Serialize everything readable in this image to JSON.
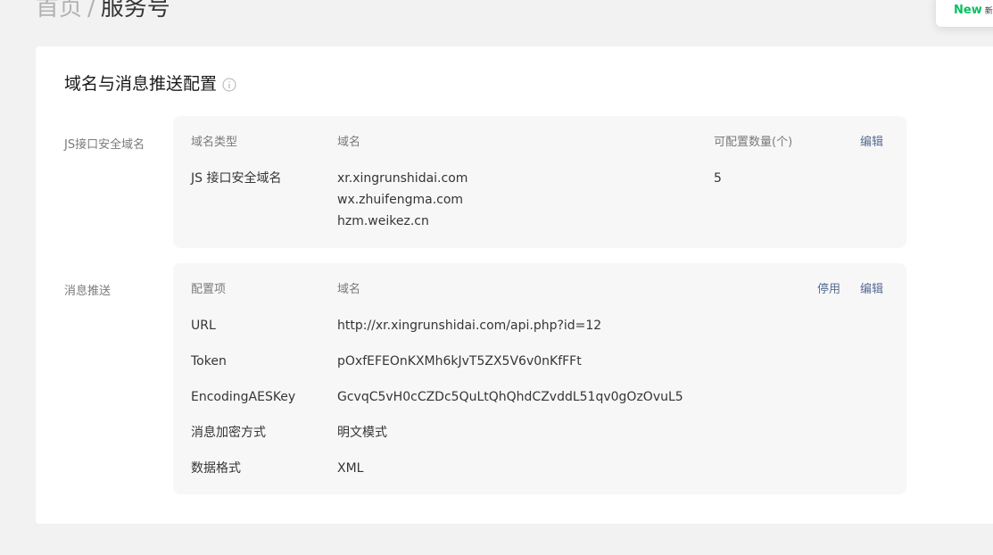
{
  "breadcrumb": {
    "home": "首页",
    "separator": "/",
    "current": "服务号"
  },
  "new_popup": {
    "badge": "New",
    "text": "新增"
  },
  "card": {
    "title": "域名与消息推送配置"
  },
  "js_domain": {
    "section_label": "JS接口安全域名",
    "headers": {
      "type": "域名类型",
      "domain": "域名",
      "quota": "可配置数量(个)"
    },
    "edit_label": "编辑",
    "row": {
      "type": "JS 接口安全域名",
      "domains": [
        "xr.xingrunshidai.com",
        "wx.zhuifengma.com",
        "hzm.weikez.cn"
      ],
      "quota": "5"
    }
  },
  "push": {
    "section_label": "消息推送",
    "headers": {
      "item": "配置项",
      "domain": "域名"
    },
    "disable_label": "停用",
    "edit_label": "编辑",
    "rows": [
      {
        "key": "URL",
        "value": "http://xr.xingrunshidai.com/api.php?id=12"
      },
      {
        "key": "Token",
        "value": "pOxfEFEOnKXMh6kJvT5ZX5V6v0nKfFFt"
      },
      {
        "key": "EncodingAESKey",
        "value": "GcvqC5vH0cCZDc5QuLtQhQhdCZvddL51qv0gOzOvuL5"
      },
      {
        "key": "消息加密方式",
        "value": "明文模式"
      },
      {
        "key": "数据格式",
        "value": "XML"
      }
    ]
  }
}
